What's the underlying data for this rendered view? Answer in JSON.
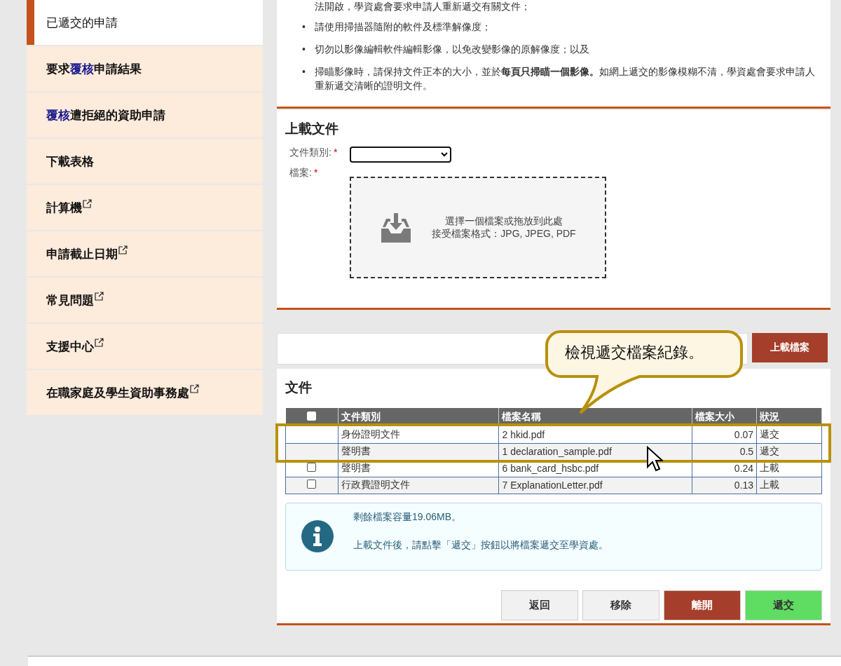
{
  "sidebar": {
    "items": [
      {
        "parts": [
          {
            "text": "已遞交的申請",
            "highlight": false
          }
        ],
        "external": false,
        "selected": true
      },
      {
        "parts": [
          {
            "text": "要求",
            "highlight": false
          },
          {
            "text": "覆核",
            "highlight": true
          },
          {
            "text": "申請結果",
            "highlight": false
          }
        ],
        "external": false,
        "selected": false
      },
      {
        "parts": [
          {
            "text": "覆核",
            "highlight": true
          },
          {
            "text": "遭拒絕的資助申請",
            "highlight": false
          }
        ],
        "external": false,
        "selected": false
      },
      {
        "parts": [
          {
            "text": "下載表格",
            "highlight": false
          }
        ],
        "external": false,
        "selected": false
      },
      {
        "parts": [
          {
            "text": "計算機",
            "highlight": false
          }
        ],
        "external": true,
        "selected": false
      },
      {
        "parts": [
          {
            "text": "申請截止日期",
            "highlight": false
          }
        ],
        "external": true,
        "selected": false
      },
      {
        "parts": [
          {
            "text": "常見問題",
            "highlight": false
          }
        ],
        "external": true,
        "selected": false
      },
      {
        "parts": [
          {
            "text": "支援中心",
            "highlight": false
          }
        ],
        "external": true,
        "selected": false
      },
      {
        "parts": [
          {
            "text": "在職家庭及學生資助事務處",
            "highlight": false
          }
        ],
        "external": true,
        "selected": false
      }
    ]
  },
  "guidelines": {
    "marker": "•",
    "continued_line": "法開啟，學資處會要求申請人重新遞交有關文件；",
    "bullets": [
      "請使用掃描器隨附的軟件及標準解像度；",
      "切勿以影像編輯軟件編輯影像，以免改變影像的原解像度；以及",
      "掃瞄影像時，請保持文件正本的大小，並於**每頁只掃瞄一個影像。**如網上遞交的影像模糊不清，學資處會要求申請人重新遞交清晰的證明文件。"
    ]
  },
  "upload": {
    "title": "上載文件",
    "type_label": "文件類別:",
    "file_label": "檔案:",
    "required_mark": "*",
    "dropzone_line1": "選擇一個檔案或拖放到此處",
    "dropzone_line2": "接受檔案格式：JPG, JPEG, PDF"
  },
  "upload_button": "上載檔案",
  "callout": "檢視遞交檔案紀錄。",
  "files": {
    "title": "文件",
    "header_checked": false,
    "columns": [
      "文件類別",
      "檔案名稱",
      "檔案大小",
      "狀況"
    ],
    "rows": [
      {
        "selectable": false,
        "type": "身份證明文件",
        "name": "2 hkid.pdf",
        "size": "0.07",
        "status": "遞交"
      },
      {
        "selectable": false,
        "type": "聲明書",
        "name": "1 declaration_sample.pdf",
        "size": "0.5",
        "status": "遞交"
      },
      {
        "selectable": true,
        "checked": false,
        "type": "聲明書",
        "name": "6 bank_card_hsbc.pdf",
        "size": "0.24",
        "status": "上載"
      },
      {
        "selectable": true,
        "checked": false,
        "type": "行政費證明文件",
        "name": "7 ExplanationLetter.pdf",
        "size": "0.13",
        "status": "上載"
      }
    ],
    "info_lines": [
      "剩餘檔案容量19.06MB。",
      "上載文件後，請點擊「遞交」按鈕以將檔案遞交至學資處。"
    ],
    "buttons": [
      {
        "label": "返回",
        "kind": "plain"
      },
      {
        "label": "移除",
        "kind": "plain"
      },
      {
        "label": "離開",
        "kind": "danger"
      },
      {
        "label": "遞交",
        "kind": "go"
      }
    ]
  }
}
